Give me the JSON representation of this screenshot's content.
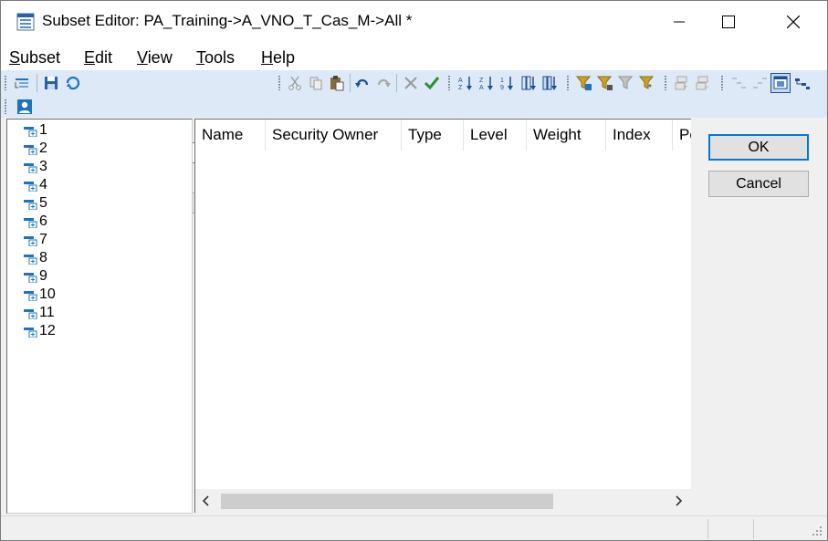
{
  "window": {
    "title": "Subset Editor:  PA_Training->A_VNO_T_Cas_M->All  *",
    "controls": [
      "minimize",
      "maximize",
      "close"
    ]
  },
  "menu": [
    {
      "label": "Subset",
      "accel": "S",
      "rest": "ubset"
    },
    {
      "label": "Edit",
      "accel": "E",
      "rest": "dit"
    },
    {
      "label": "View",
      "accel": "V",
      "rest": "iew"
    },
    {
      "label": "Tools",
      "accel": "T",
      "rest": "ools"
    },
    {
      "label": "Help",
      "accel": "H",
      "rest": "elp"
    }
  ],
  "toolbar": {
    "subset_combo_value": "",
    "alias_combo_value": ""
  },
  "tree": {
    "items": [
      "1",
      "2",
      "3",
      "4",
      "5",
      "6",
      "7",
      "8",
      "9",
      "10",
      "11",
      "12"
    ]
  },
  "grid": {
    "columns": [
      "Name",
      "Security Owner",
      "Type",
      "Level",
      "Weight",
      "Index",
      "Po"
    ]
  },
  "buttons": {
    "ok": "OK",
    "cancel": "Cancel"
  },
  "colors": {
    "toolbar_bg": "#dde9f6",
    "accent": "#0078d7",
    "icon_blue": "#1e73be",
    "icon_green": "#2f8f2f",
    "filter_gold": "#c9a227"
  }
}
